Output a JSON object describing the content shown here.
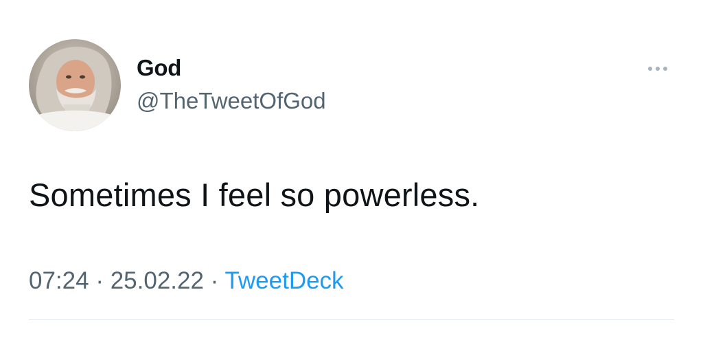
{
  "author": {
    "display_name": "God",
    "handle": "@TheTweetOfGod",
    "avatar_icon": "bearded-man-avatar"
  },
  "more_icon": "ellipsis-icon",
  "tweet": {
    "text": "Sometimes I feel so powerless."
  },
  "meta": {
    "time": "07:24",
    "separator1": " · ",
    "date": "25.02.22",
    "separator2": " · ",
    "source": "TweetDeck"
  },
  "colors": {
    "text_primary": "#0f1419",
    "text_secondary": "#536471",
    "link": "#1d9bf0",
    "divider": "#e1e6ea"
  }
}
